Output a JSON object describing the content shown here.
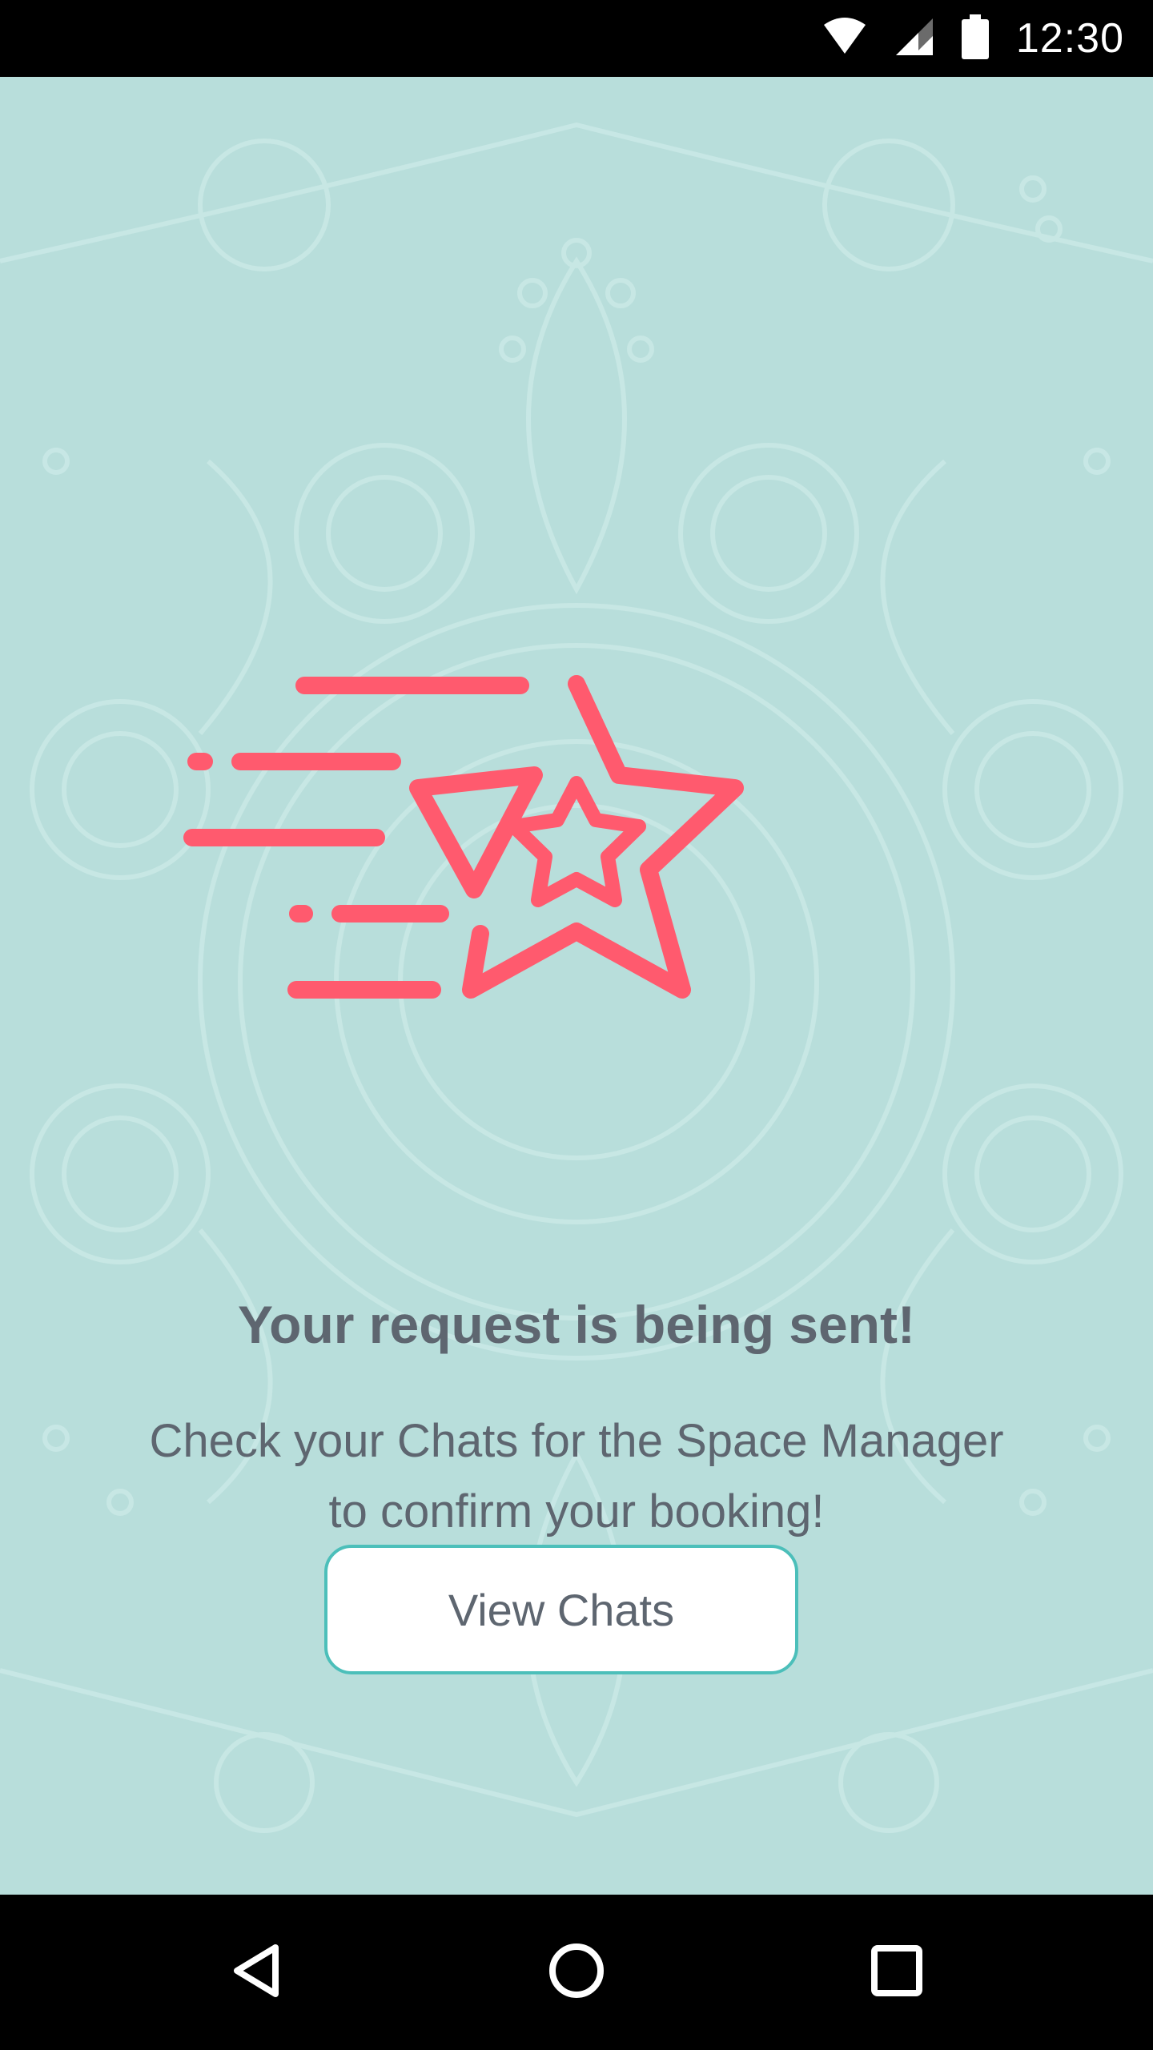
{
  "status_bar": {
    "time": "12:30",
    "icons": [
      "wifi-icon",
      "signal-icon",
      "battery-icon"
    ]
  },
  "main": {
    "title": "Your request is being sent!",
    "subtitle": "Check your Chats for the Space Manager to confirm your booking!",
    "button_label": "View Chats"
  },
  "nav_bar": {
    "buttons": [
      "back-icon",
      "home-icon",
      "recents-icon"
    ]
  },
  "colors": {
    "background": "#b8dedb",
    "accent": "#ff5a6e",
    "text": "#5e6670",
    "button_border": "#4cbfba"
  }
}
